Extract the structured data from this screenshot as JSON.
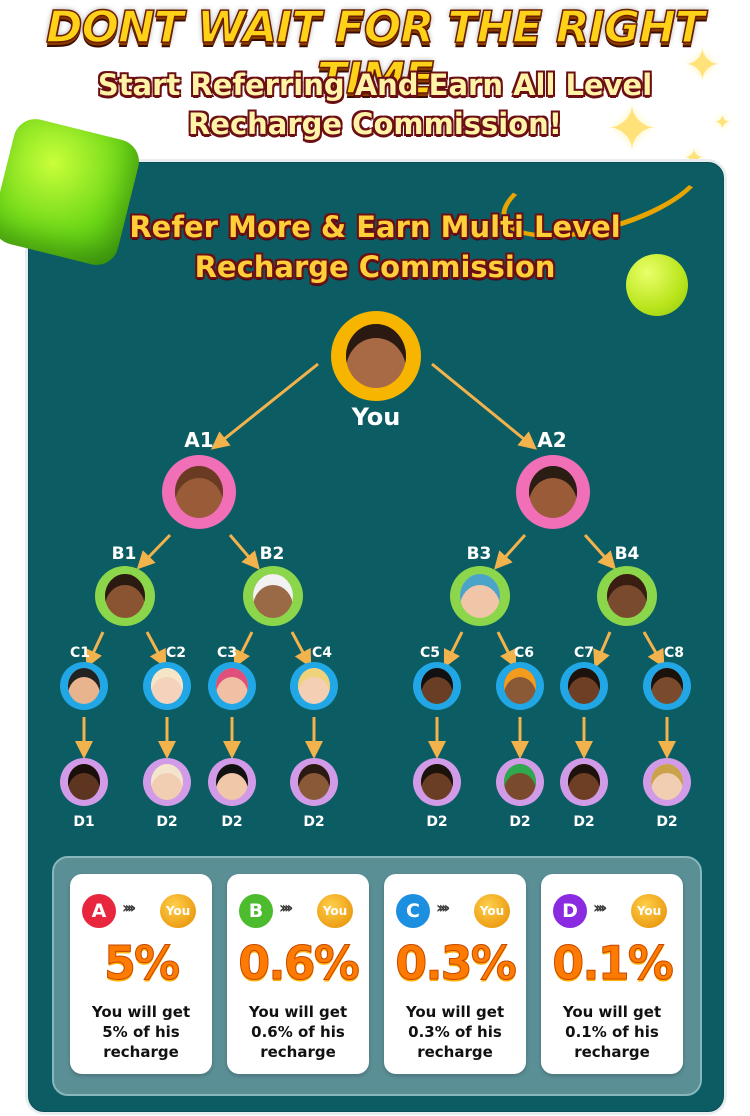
{
  "header": {
    "headline": "DONT WAIT FOR THE RIGHT TIME",
    "subtitle_line1": "Start Referring And Earn All Level",
    "subtitle_line2": "Recharge Commission!"
  },
  "panel": {
    "title_line1": "Refer More & Earn Multi Level",
    "title_line2": "Recharge Commission"
  },
  "tree": {
    "root_label": "You",
    "level_a": [
      "A1",
      "A2"
    ],
    "level_b": [
      "B1",
      "B2",
      "B3",
      "B4"
    ],
    "level_c": [
      "C1",
      "C2",
      "C3",
      "C4",
      "C5",
      "C6",
      "C7",
      "C8"
    ],
    "level_d": [
      "D1",
      "D2",
      "D2",
      "D2",
      "D2",
      "D2",
      "D2",
      "D2"
    ],
    "colors": {
      "root_ring": "#f7b500",
      "a_ring": "#f06fb7",
      "b_ring": "#8bd64a",
      "c_ring": "#22a7e6",
      "d_ring": "#d29be8",
      "arrow": "#f2b24c"
    }
  },
  "cards": [
    {
      "letter": "A",
      "you": "You",
      "percent": "5%",
      "line1": "You will get",
      "line2": "5% of his",
      "line3": "recharge",
      "color": "#e8263d"
    },
    {
      "letter": "B",
      "you": "You",
      "percent": "0.6%",
      "line1": "You will get",
      "line2": "0.6% of his",
      "line3": "recharge",
      "color": "#4cbb2e"
    },
    {
      "letter": "C",
      "you": "You",
      "percent": "0.3%",
      "line1": "You will get",
      "line2": "0.3% of his",
      "line3": "recharge",
      "color": "#1d8fe0"
    },
    {
      "letter": "D",
      "you": "You",
      "percent": "0.1%",
      "line1": "You will get",
      "line2": "0.1% of his",
      "line3": "recharge",
      "color": "#8a2be2"
    }
  ]
}
